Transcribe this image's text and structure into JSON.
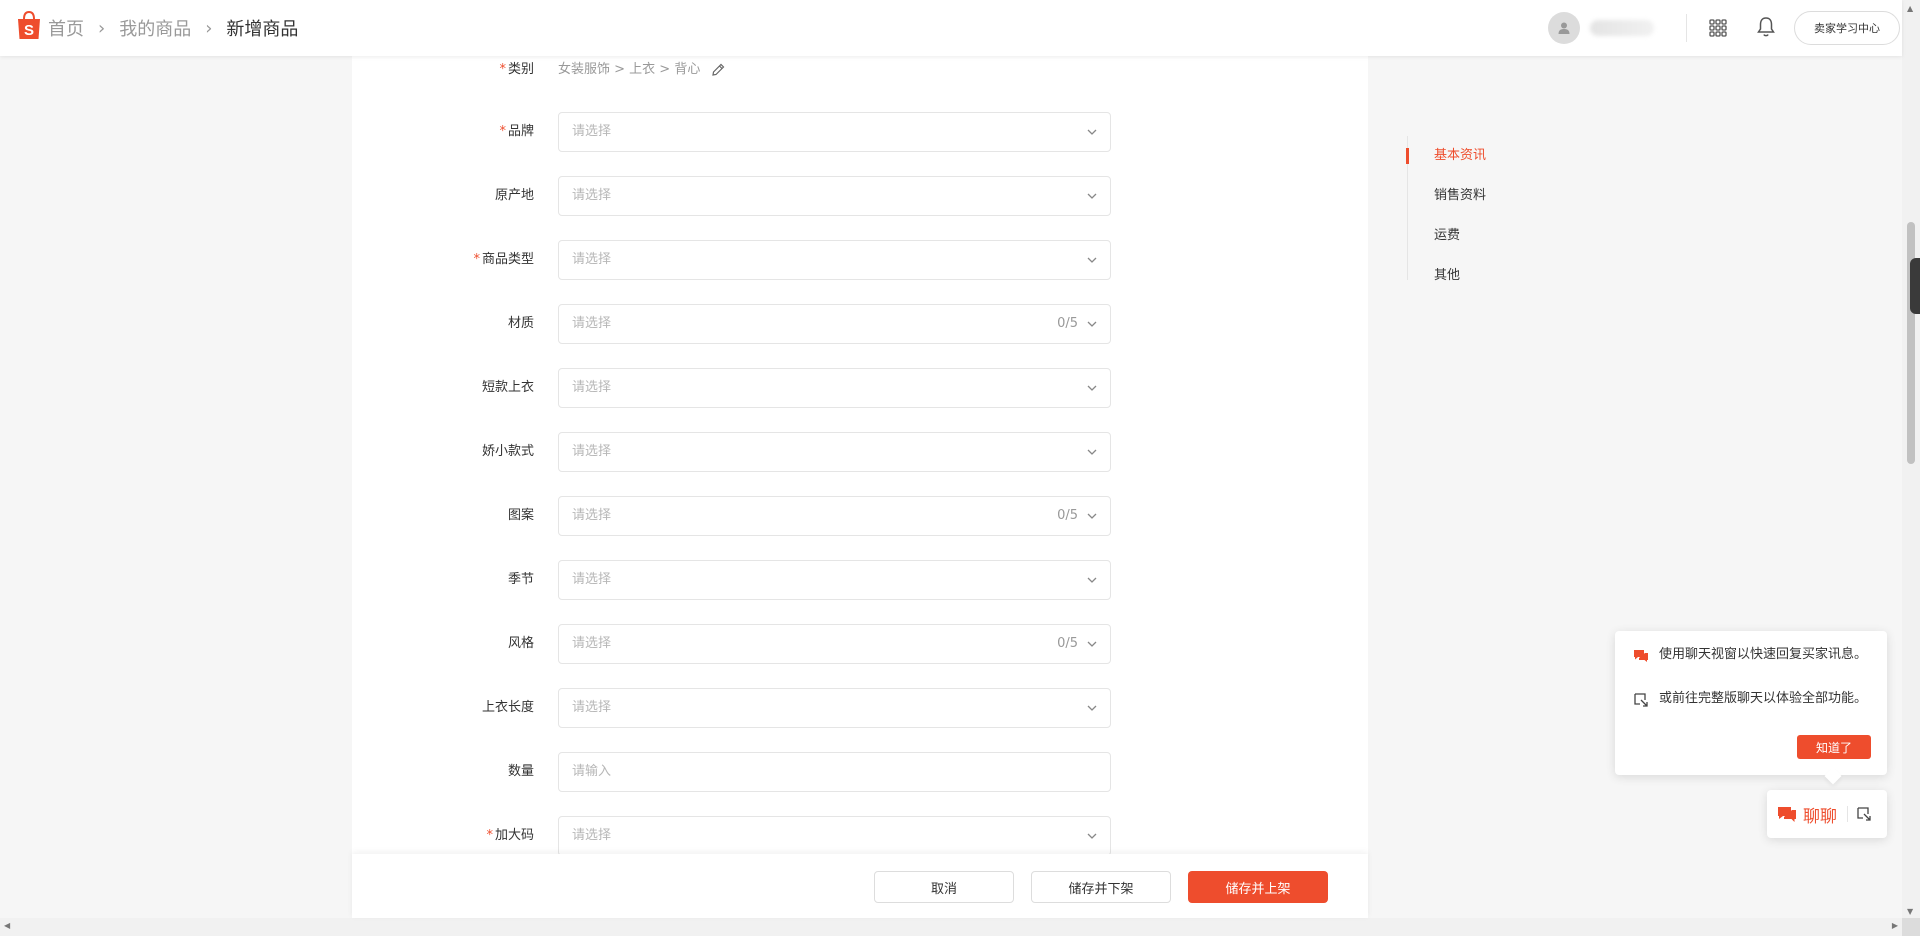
{
  "header": {
    "breadcrumbs": [
      "首页",
      "我的商品",
      "新增商品"
    ],
    "learn_center": "卖家学习中心"
  },
  "category": {
    "label": "类别",
    "value": "女装服饰 > 上衣 > 背心"
  },
  "fields": [
    {
      "label": "品牌",
      "required": "*",
      "placeholder": "请选择",
      "count": ""
    },
    {
      "label": "原产地",
      "required": "",
      "placeholder": "请选择",
      "count": ""
    },
    {
      "label": "商品类型",
      "required": "*",
      "placeholder": "请选择",
      "count": ""
    },
    {
      "label": "材质",
      "required": "",
      "placeholder": "请选择",
      "count": "0/5"
    },
    {
      "label": "短款上衣",
      "required": "",
      "placeholder": "请选择",
      "count": ""
    },
    {
      "label": "娇小款式",
      "required": "",
      "placeholder": "请选择",
      "count": ""
    },
    {
      "label": "图案",
      "required": "",
      "placeholder": "请选择",
      "count": "0/5"
    },
    {
      "label": "季节",
      "required": "",
      "placeholder": "请选择",
      "count": ""
    },
    {
      "label": "风格",
      "required": "",
      "placeholder": "请选择",
      "count": "0/5"
    },
    {
      "label": "上衣长度",
      "required": "",
      "placeholder": "请选择",
      "count": ""
    },
    {
      "label": "数量",
      "required": "",
      "placeholder": "请输入",
      "count": ""
    },
    {
      "label": "加大码",
      "required": "*",
      "placeholder": "请选择",
      "count": ""
    }
  ],
  "footer": {
    "cancel": "取消",
    "save_unpublish": "储存并下架",
    "save_publish": "储存并上架"
  },
  "sidenav": {
    "items": [
      "基本资讯",
      "销售资料",
      "运费",
      "其他"
    ],
    "active": "基本资讯"
  },
  "chat_popover": {
    "line1": "使用聊天视窗以快速回复买家讯息。",
    "line2": "或前往完整版聊天以体验全部功能。",
    "ok": "知道了"
  },
  "chat_button": {
    "label": "聊聊"
  },
  "colors": {
    "accent": "#ee4d2d"
  },
  "icons": [
    "shopee-bag-icon",
    "user-avatar-icon",
    "apps-grid-icon",
    "bell-icon",
    "edit-pencil-icon",
    "chevron-down-icon",
    "chat-bubble-icon",
    "external-window-icon"
  ]
}
